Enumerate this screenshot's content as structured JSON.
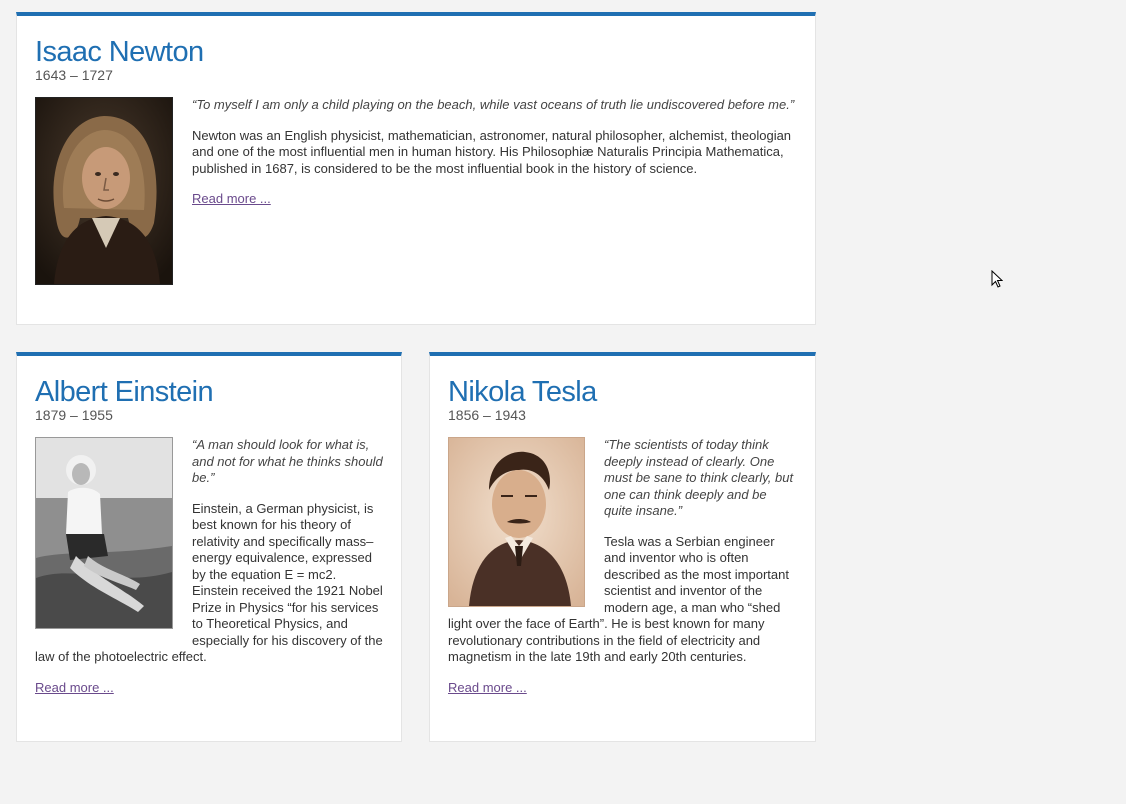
{
  "colors": {
    "accent": "#1f6fb2",
    "link": "#6a4a8c",
    "background": "#f3f3f3"
  },
  "cards": [
    {
      "name": "Isaac Newton",
      "dates": "1643 – 1727",
      "quote": "“To myself I am only a child playing on the beach, while vast oceans of truth lie undiscovered before me.”",
      "bio": "Newton was an English physicist, mathematician, astronomer, natural philosopher, alchemist, theologian and one of the most influential men in human history. His Philosophiæ Naturalis Principia Mathematica, published in 1687, is considered to be the most influential book in the history of science.",
      "read_more": "Read more ..."
    },
    {
      "name": "Albert Einstein",
      "dates": "1879 – 1955",
      "quote": "“A man should look for what is, and not for what he thinks should be.”",
      "bio": "Einstein, a German physicist, is best known for his theory of relativity and specifically mass–energy equivalence, expressed by the equation E = mc2. Einstein received the 1921 Nobel Prize in Physics “for his services to Theoretical Physics, and especially for his discovery of the law of the photoelectric effect.",
      "read_more": "Read more ..."
    },
    {
      "name": "Nikola Tesla",
      "dates": "1856 – 1943",
      "quote": "“The scientists of today think deeply instead of clearly. One must be sane to think clearly, but one can think deeply and be quite insane.”",
      "bio": "Tesla was a Serbian engineer and inventor who is often described as the most important scientist and inventor of the modern age, a man who “shed light over the face of Earth”. He is best known for many revolutionary contributions in the field of electricity and magnetism in the late 19th and early 20th centuries.",
      "read_more": "Read more ..."
    }
  ],
  "icons": {
    "cursor": "mouse-pointer-icon"
  }
}
